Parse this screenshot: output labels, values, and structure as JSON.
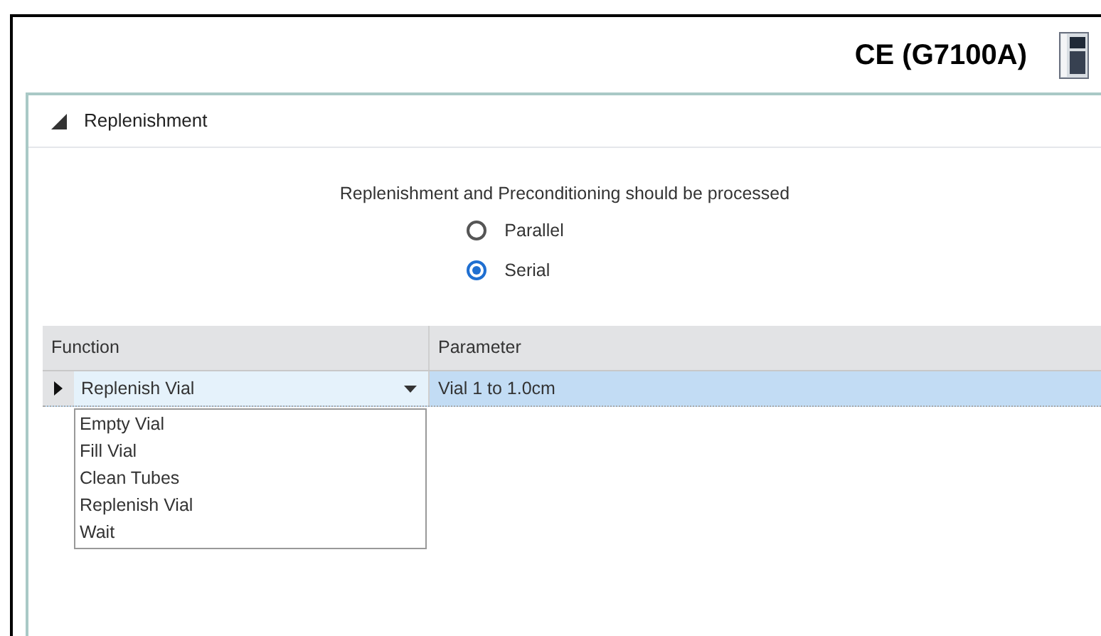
{
  "header": {
    "title": "CE (G7100A)"
  },
  "section": {
    "title": "Replenishment",
    "expanded": true
  },
  "processing": {
    "prompt": "Replenishment and Preconditioning should be processed",
    "options": [
      {
        "label": "Parallel",
        "selected": false
      },
      {
        "label": "Serial",
        "selected": true
      }
    ]
  },
  "table": {
    "columns": [
      "Function",
      "Parameter"
    ],
    "rows": [
      {
        "function": "Replenish Vial",
        "parameter": "Vial 1 to 1.0cm",
        "selected": true
      }
    ]
  },
  "dropdown": {
    "items": [
      "Empty Vial",
      "Fill Vial",
      "Clean Tubes",
      "Replenish Vial",
      "Wait"
    ]
  }
}
